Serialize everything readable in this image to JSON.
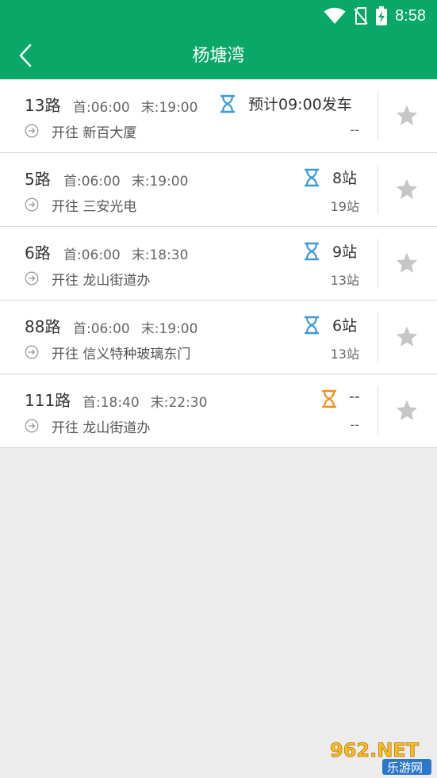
{
  "status_bar": {
    "time": "8:58",
    "icons": [
      "wifi-icon",
      "no-sim-icon",
      "battery-charging-icon"
    ]
  },
  "header": {
    "title": "杨塘湾",
    "back_icon": "chevron-left-icon"
  },
  "colors": {
    "brand_green": "#09a768",
    "hourglass_blue": "#3a9bd5",
    "hourglass_orange": "#f0901e",
    "star_gray": "#c6c6c6"
  },
  "routes": [
    {
      "name": "13路",
      "first": "首:06:00",
      "last": "末:19:00",
      "arrival": "预计09:00发车",
      "destination": "开往 新百大厦",
      "stops": "--",
      "hourglass": "blue"
    },
    {
      "name": "5路",
      "first": "首:06:00",
      "last": "末:19:00",
      "arrival": "8站",
      "destination": "开往 三安光电",
      "stops": "19站",
      "hourglass": "blue"
    },
    {
      "name": "6路",
      "first": "首:06:00",
      "last": "末:18:30",
      "arrival": "9站",
      "destination": "开往 龙山街道办",
      "stops": "13站",
      "hourglass": "blue"
    },
    {
      "name": "88路",
      "first": "首:06:00",
      "last": "末:19:00",
      "arrival": "6站",
      "destination": "开往 信义特种玻璃东门",
      "stops": "13站",
      "hourglass": "blue"
    },
    {
      "name": "111路",
      "first": "首:18:40",
      "last": "末:22:30",
      "arrival": "--",
      "destination": "开往 龙山街道办",
      "stops": "--",
      "hourglass": "orange"
    }
  ],
  "watermark": {
    "text_main": "962.NET",
    "text_sub": "乐游网"
  }
}
